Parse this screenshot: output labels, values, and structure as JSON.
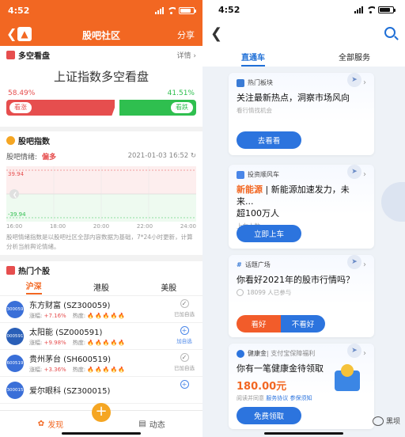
{
  "left": {
    "status": {
      "time": "4:52"
    },
    "header": {
      "title": "股吧社区",
      "share": "分享",
      "logo": ""
    },
    "bullbear": {
      "section": "多空看盘",
      "more": "详情",
      "title": "上证指数多空看盘",
      "bear_pct": "58.49%",
      "bull_pct": "41.51%",
      "bear_pct_value": 58.49,
      "bull_pct_value": 41.51,
      "bear_label": "看涨",
      "bull_label": "看跌",
      "colors": {
        "bear": "#e64e4e",
        "bull": "#2fbf4f"
      }
    },
    "index": {
      "section": "股吧指数",
      "mood_label": "股吧情绪:",
      "mood": "偏多",
      "time": "2021-01-03 16:52",
      "y_top": "39.94",
      "y_bottom": "-39.94",
      "x_ticks": [
        "16:00",
        "18:00",
        "20:00",
        "22:00",
        "24:00"
      ],
      "desc": "股吧情绪指数是以股吧社区全部内容数据为基础，7*24小时更新，计算分析当前舆论情绪。"
    },
    "hot": {
      "section": "热门个股",
      "tabs": [
        "沪深",
        "港股",
        "美股"
      ],
      "stocks": [
        {
          "logo": "300059",
          "name": "东方财富 (SZ300059)",
          "change_label": "涨幅",
          "change": "+7.16%",
          "heat_label": "热度",
          "fires": "🔥🔥🔥🔥🔥",
          "action": "已加自选",
          "added": true,
          "color": "#3a6fd8"
        },
        {
          "logo": "000591",
          "name": "太阳能 (SZ000591)",
          "change_label": "涨幅",
          "change": "+9.98%",
          "heat_label": "热度",
          "fires": "🔥🔥🔥🔥🔥",
          "action": "加自选",
          "added": false,
          "color": "#2a5fb8"
        },
        {
          "logo": "600519",
          "name": "贵州茅台 (SH600519)",
          "change_label": "涨幅",
          "change": "+3.36%",
          "heat_label": "热度",
          "fires": "🔥🔥🔥🔥🔥",
          "action": "已加自选",
          "added": true,
          "color": "#3a6fd8"
        },
        {
          "logo": "300015",
          "name": "爱尔眼科 (SZ300015)",
          "change_label": "",
          "change": "",
          "heat_label": "",
          "fires": "",
          "action": "",
          "added": false,
          "color": "#3a6fd8"
        }
      ]
    },
    "bottom": {
      "discover": "发现",
      "plus": "+",
      "feed": "动态"
    }
  },
  "right": {
    "status": {
      "time": "4:52"
    },
    "tabs": [
      "直通车",
      "全部服务"
    ],
    "cards": [
      {
        "tag": "热门板块",
        "title": "关注最新热点，洞察市场风向",
        "sub": "看行情找机会",
        "button": "去看看"
      },
      {
        "tag": "投资顺风车",
        "title_hl": "新能源",
        "title_rest": " | 新能源加速发力，未来...",
        "title2": "超100万人",
        "sub": "上车人数",
        "button": "立即上车"
      },
      {
        "tag": "话题广场",
        "title": "你看好2021年的股市行情吗？",
        "people": "18099 人已参与",
        "button_yes": "看好",
        "button_no": "不看好"
      },
      {
        "tag": "健康金",
        "tag2": " | 支付宝保障福利",
        "title": "你有一笔健康金待领取",
        "price": "180.00元",
        "small_a": "阅读并同意",
        "small_b": "服务协议",
        "small_c": "参保须知",
        "button": "免费领取"
      }
    ],
    "watermark": "黑坝"
  }
}
